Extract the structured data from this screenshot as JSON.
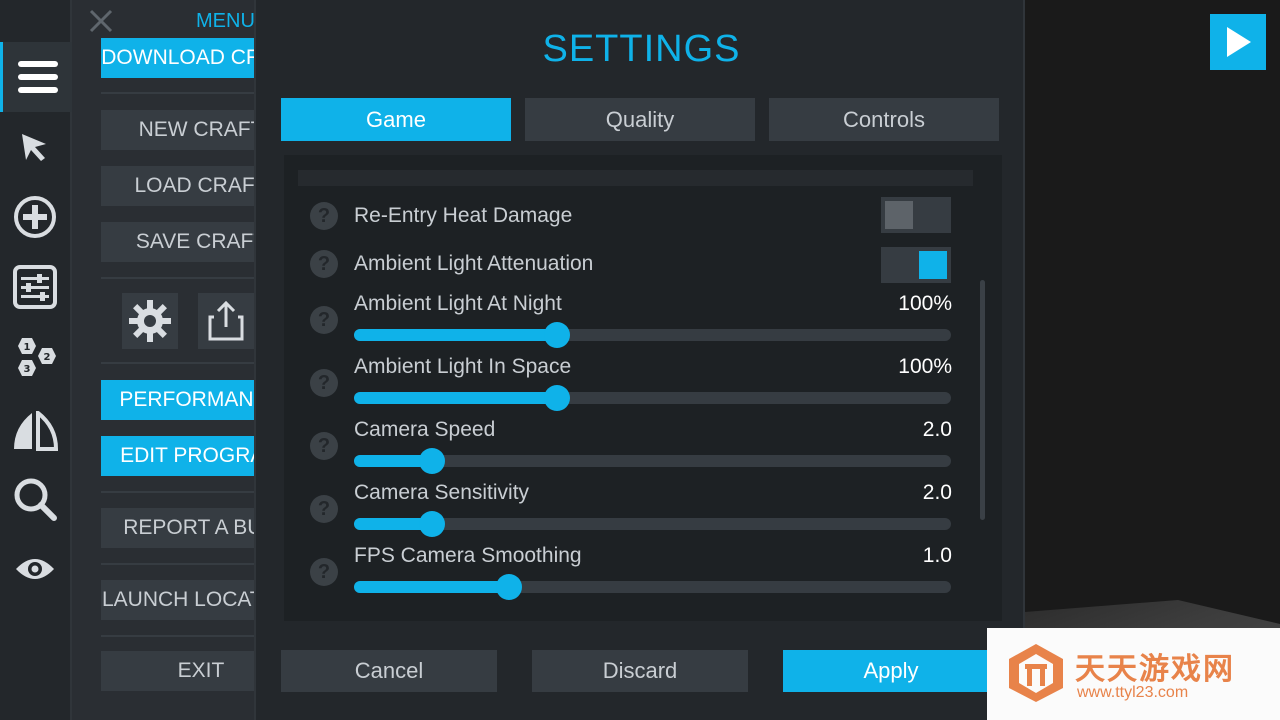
{
  "menu": {
    "title": "MENU",
    "buttons": [
      {
        "label": "DOWNLOAD CRAFT",
        "style": "blue"
      },
      {
        "label": "NEW CRAFT",
        "style": "gray"
      },
      {
        "label": "LOAD CRAFT",
        "style": "gray"
      },
      {
        "label": "SAVE CRAFT",
        "style": "gray"
      },
      {
        "label": "PERFORMANCE",
        "style": "blue"
      },
      {
        "label": "EDIT PROGRAM",
        "style": "blue"
      },
      {
        "label": "REPORT A BUG",
        "style": "gray"
      },
      {
        "label": "LAUNCH LOCATION",
        "style": "gray"
      },
      {
        "label": "EXIT",
        "style": "gray"
      }
    ],
    "icon_buttons": [
      "gear-icon",
      "share-icon"
    ]
  },
  "iconbar": [
    "menu-icon",
    "cursor-icon",
    "add-part-icon",
    "sliders-icon",
    "staging-icon",
    "symmetry-icon",
    "search-icon",
    "eye-icon"
  ],
  "settings": {
    "title": "SETTINGS",
    "tabs": [
      {
        "label": "Game",
        "active": true
      },
      {
        "label": "Quality",
        "active": false
      },
      {
        "label": "Controls",
        "active": false
      }
    ],
    "toggles": [
      {
        "label": "Re-Entry Heat Damage",
        "on": false
      },
      {
        "label": "Ambient Light Attenuation",
        "on": true
      }
    ],
    "sliders": [
      {
        "label": "Ambient Light At Night",
        "value": "100%",
        "fraction": 0.34
      },
      {
        "label": "Ambient Light In Space",
        "value": "100%",
        "fraction": 0.34
      },
      {
        "label": "Camera Speed",
        "value": "2.0",
        "fraction": 0.13
      },
      {
        "label": "Camera Sensitivity",
        "value": "2.0",
        "fraction": 0.13
      },
      {
        "label": "FPS Camera Smoothing",
        "value": "1.0",
        "fraction": 0.26
      }
    ],
    "footer": {
      "cancel": "Cancel",
      "discard": "Discard",
      "apply": "Apply"
    }
  },
  "watermark": {
    "name": "天天游戏网",
    "url": "www.ttyl23.com"
  },
  "colors": {
    "accent": "#0fb2e9",
    "panel": "#23272b",
    "button": "#363c42"
  }
}
